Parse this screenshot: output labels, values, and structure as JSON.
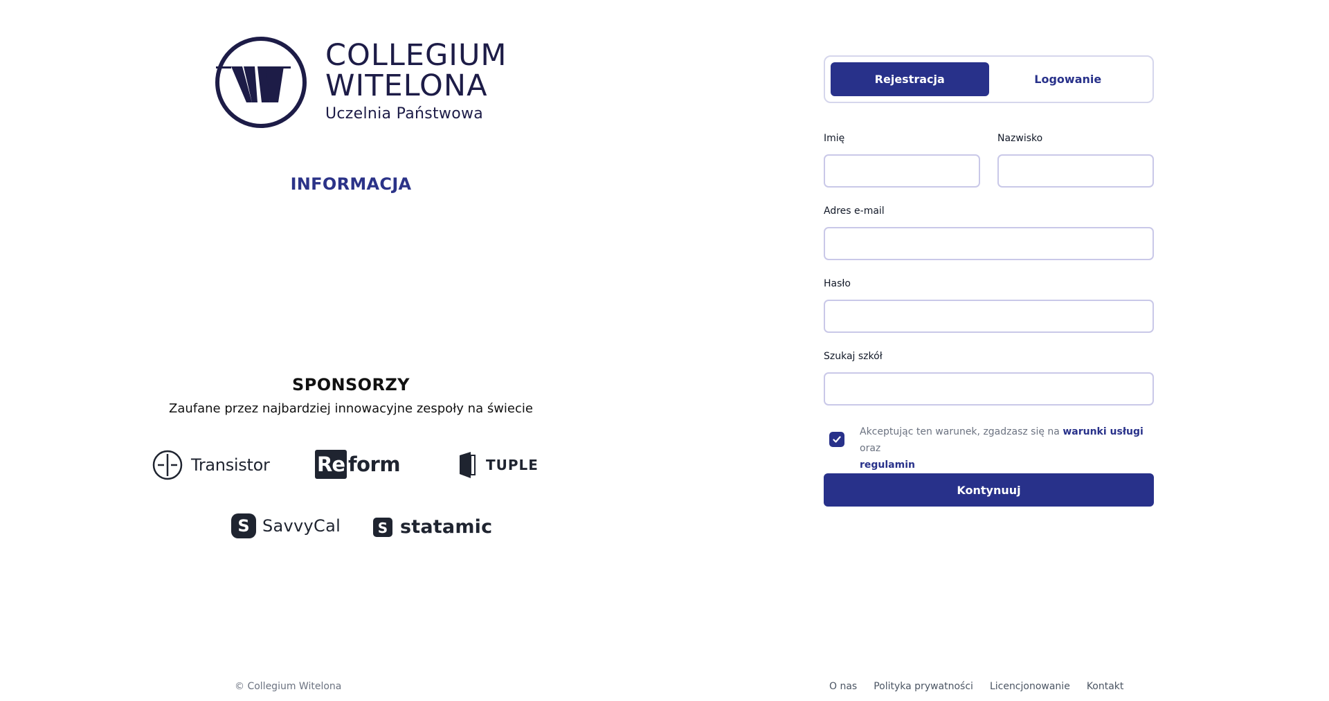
{
  "brand": {
    "line1": "COLLEGIUM",
    "line2": "WITELONA",
    "subtitle": "Uczelnia Państwowa",
    "color": "#1d1c47"
  },
  "info": {
    "heading": "INFORMACJA"
  },
  "sponsors": {
    "heading": "SPONSORZY",
    "subtitle": "Zaufane przez najbardziej innowacyjne zespoły na świecie",
    "items": [
      {
        "name": "Transistor",
        "icon": "transistor-logo-icon"
      },
      {
        "re": "Re",
        "rest": "form",
        "icon": "reform-logo-icon"
      },
      {
        "name": "TUPLE",
        "icon": "tuple-logo-icon"
      },
      {
        "name": "SavvyCal",
        "icon": "savvycal-logo-icon"
      },
      {
        "name": "statamic",
        "icon": "statamic-logo-icon"
      }
    ]
  },
  "tabs": {
    "register": "Rejestracja",
    "login": "Logowanie",
    "active": "register"
  },
  "form": {
    "first_name": {
      "label": "Imię",
      "value": ""
    },
    "last_name": {
      "label": "Nazwisko",
      "value": ""
    },
    "email": {
      "label": "Adres e-mail",
      "value": ""
    },
    "password": {
      "label": "Hasło",
      "value": ""
    },
    "school": {
      "label": "Szukaj szkół",
      "value": ""
    },
    "consent": {
      "checked": true,
      "text_before": "Akceptując ten warunek, zgadzasz się na ",
      "terms_link": "warunki usługi",
      "text_middle": " oraz ",
      "rules_link": "regulamin"
    },
    "submit_label": "Kontynuuj"
  },
  "footer": {
    "copyright": "© Collegium Witelona",
    "links": [
      "O nas",
      "Polityka prywatności",
      "Licencjonowanie",
      "Kontakt"
    ]
  },
  "colors": {
    "primary": "#28318a",
    "input_border": "#c9c8e8",
    "muted_text": "#6b7280"
  }
}
